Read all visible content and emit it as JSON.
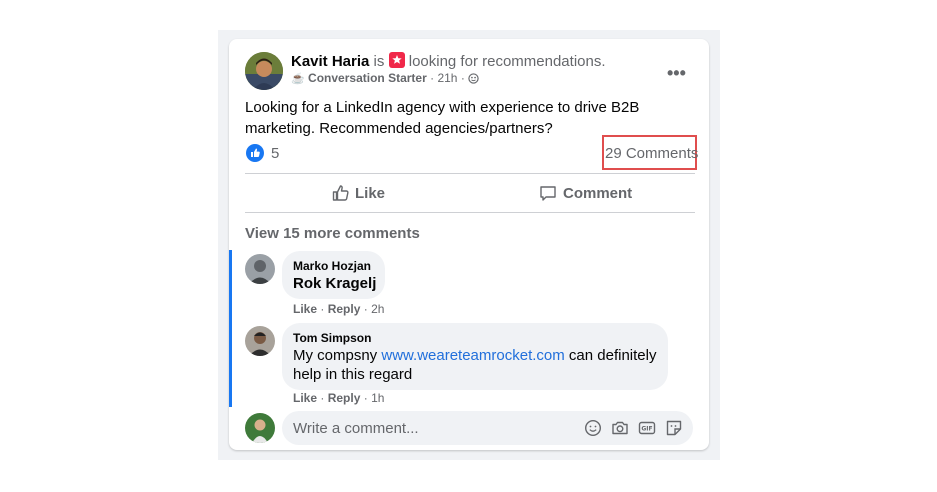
{
  "post": {
    "author": "Kavit Haria",
    "is_text": "is",
    "activity": "looking for recommendations.",
    "badge": "Conversation Starter",
    "time": "21h",
    "body": "Looking for a LinkedIn agency with experience to drive B2B marketing. Recommended agencies/partners?",
    "reactions_count": "5",
    "comments_count": "29 Comments",
    "like_label": "Like",
    "comment_label": "Comment"
  },
  "comments": {
    "view_more": "View 15 more comments",
    "items": [
      {
        "author": "Marko Hozjan",
        "text": "Rok Kragelj",
        "like": "Like",
        "reply": "Reply",
        "time": "2h"
      },
      {
        "author": "Tom Simpson",
        "text_before": "My compsny ",
        "link": "www.weareteamrocket.com",
        "text_after": " can definitely",
        "text_line2": "help in this regard",
        "like": "Like",
        "reply": "Reply",
        "time": "1h"
      }
    ]
  },
  "composer": {
    "placeholder": "Write a comment..."
  },
  "colors": {
    "highlight": "#e04e4e",
    "accent": "#1877f2",
    "link": "#216fdb"
  }
}
